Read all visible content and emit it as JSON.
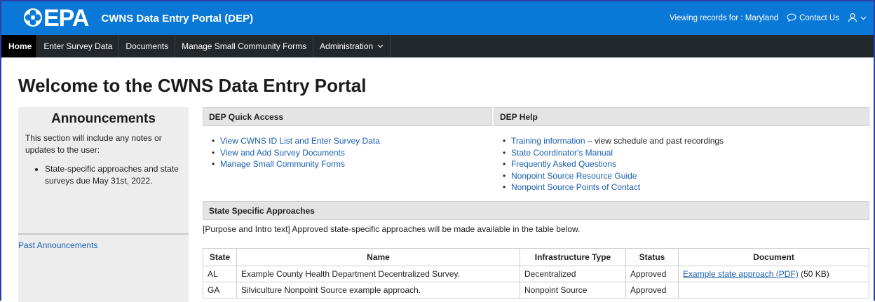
{
  "header": {
    "logo_text": "EPA",
    "app_title": "CWNS Data Entry Portal (DEP)",
    "viewing_records": "Viewing records for : Maryland",
    "contact_label": "Contact Us",
    "brand_color": "#0a78d7",
    "icons": [
      "epa-flower-icon",
      "chat-bubble-icon",
      "user-icon",
      "chevron-down-icon"
    ]
  },
  "nav": {
    "items": [
      {
        "label": "Home",
        "active": true
      },
      {
        "label": "Enter Survey Data"
      },
      {
        "label": "Documents"
      },
      {
        "label": "Manage Small Community Forms"
      },
      {
        "label": "Administration"
      }
    ]
  },
  "page_title": "Welcome to the CWNS Data Entry Portal",
  "announcements": {
    "title": "Announcements",
    "intro": "This section will include any notes or updates to the user:",
    "items": [
      "State-specific approaches and state surveys due May 31st, 2022."
    ],
    "past_link": "Past Announcements"
  },
  "quick_access": {
    "title": "DEP Quick Access",
    "links": [
      "View CWNS ID List and Enter Survey Data",
      "View and Add Survey Documents",
      "Manage Small Community Forms"
    ]
  },
  "help": {
    "title": "DEP Help",
    "training_link": "Training information",
    "training_suffix": " – view schedule and past recordings",
    "links": [
      "State Coordinator's Manual",
      "Frequently Asked Questions",
      "Nonpoint Source Resource Guide",
      "Nonpoint Source Points of Contact"
    ]
  },
  "approaches": {
    "title": "State Specific Approaches",
    "intro": "[Purpose and Intro text] Approved state-specific approaches will be made available in the table below.",
    "columns": [
      "State",
      "Name",
      "Infrastructure Type",
      "Status",
      "Document"
    ],
    "rows": [
      {
        "state": "AL",
        "name": "Example County Health Department Decentralized Survey.",
        "type": "Decentralized",
        "status": "Approved",
        "doc_link": "Example state approach (PDF)",
        "doc_size": " (50 KB)"
      },
      {
        "state": "GA",
        "name": "Silviculture Nonpoint Source example approach.",
        "type": "Nonpoint Source",
        "status": "Approved",
        "doc_link": "",
        "doc_size": ""
      }
    ]
  }
}
